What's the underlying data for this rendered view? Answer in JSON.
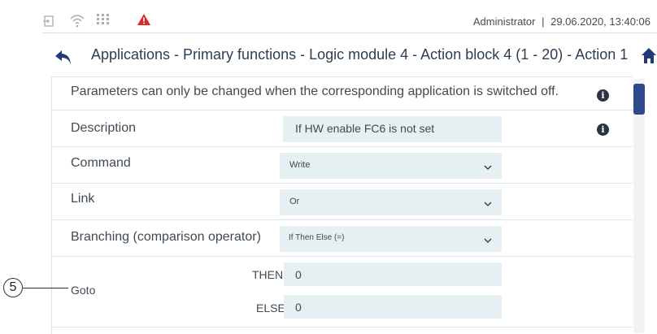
{
  "status_bar": {
    "icons": [
      "login-icon",
      "wifi-icon",
      "network-icon",
      "warning-icon"
    ],
    "user": "Administrator",
    "separator": "|",
    "datetime": "29.06.2020, 13:40:06",
    "warning_color": "#d62b2b"
  },
  "breadcrumb": {
    "path": "Applications - Primary functions - Logic module 4 - Action block 4 (1 - 20) - Action 1"
  },
  "notice": {
    "text": "Parameters can only be changed when the corresponding application is switched off."
  },
  "rows": {
    "description": {
      "label": "Description",
      "value": "If HW enable FC6 is not set"
    },
    "command": {
      "label": "Command",
      "value": "Write"
    },
    "link": {
      "label": "Link",
      "value": "Or"
    },
    "branching": {
      "label": "Branching (comparison operator)",
      "value": "If Then Else (=)"
    },
    "goto": {
      "label": "Goto",
      "then_label": "THEN",
      "then_value": "0",
      "else_label": "ELSE",
      "else_value": "0"
    }
  },
  "callout": {
    "number": "5"
  },
  "colors": {
    "accent": "#2e4a8c",
    "field_bg": "#e6eff2",
    "info_icon": "#2a3440"
  }
}
